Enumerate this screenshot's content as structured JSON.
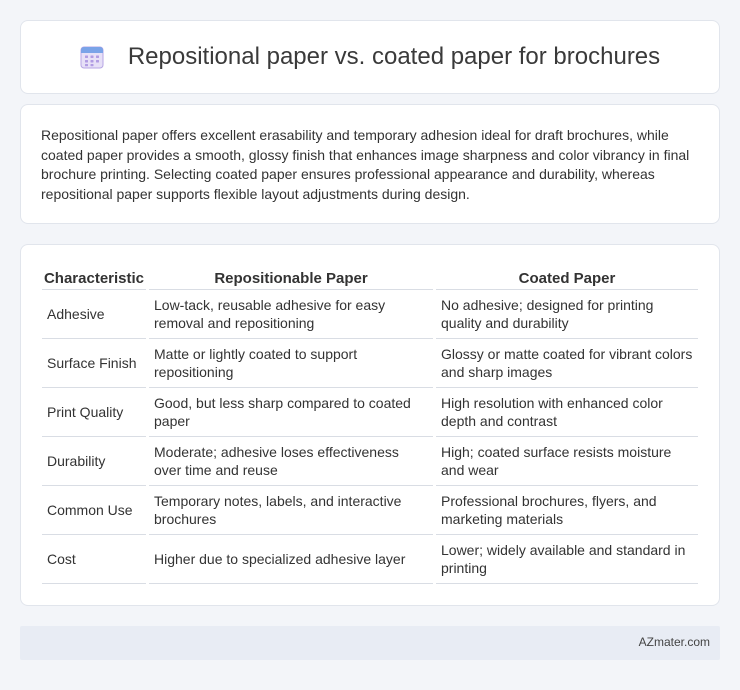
{
  "header": {
    "title": "Repositional paper vs. coated paper for brochures",
    "icon": "calendar-icon"
  },
  "intro": {
    "text": "Repositional paper offers excellent erasability and temporary adhesion ideal for draft brochures, while coated paper provides a smooth, glossy finish that enhances image sharpness and color vibrancy in final brochure printing. Selecting coated paper ensures professional appearance and durability, whereas repositional paper supports flexible layout adjustments during design."
  },
  "table": {
    "headers": [
      "Characteristic",
      "Repositionable Paper",
      "Coated Paper"
    ],
    "rows": [
      [
        "Adhesive",
        "Low-tack, reusable adhesive for easy removal and repositioning",
        "No adhesive; designed for printing quality and durability"
      ],
      [
        "Surface Finish",
        "Matte or lightly coated to support repositioning",
        "Glossy or matte coated for vibrant colors and sharp images"
      ],
      [
        "Print Quality",
        "Good, but less sharp compared to coated paper",
        "High resolution with enhanced color depth and contrast"
      ],
      [
        "Durability",
        "Moderate; adhesive loses effectiveness over time and reuse",
        "High; coated surface resists moisture and wear"
      ],
      [
        "Common Use",
        "Temporary notes, labels, and interactive brochures",
        "Professional brochures, flyers, and marketing materials"
      ],
      [
        "Cost",
        "Higher due to specialized adhesive layer",
        "Lower; widely available and standard in printing"
      ]
    ]
  },
  "footer": {
    "text": "AZmater.com"
  },
  "colors": {
    "background": "#f3f5f9",
    "card": "#ffffff",
    "border": "#e1e5ec",
    "footer": "#e8ecf4",
    "icon": "#a58fd8"
  }
}
